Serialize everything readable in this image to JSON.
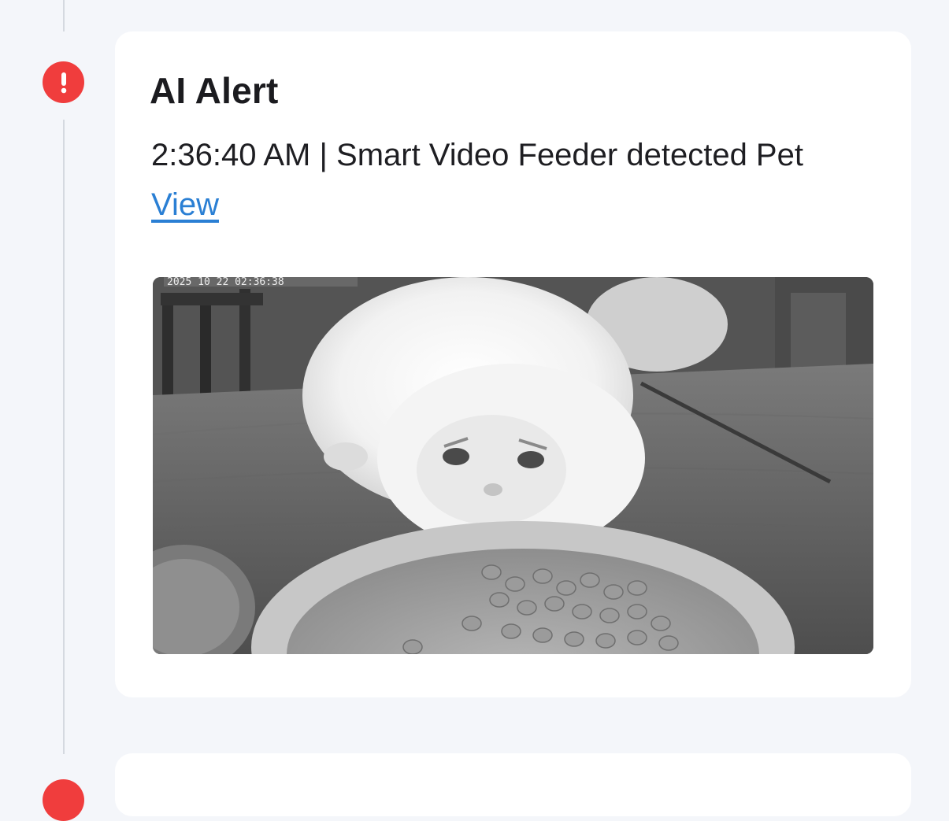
{
  "alerts": [
    {
      "title": "AI Alert",
      "time": "2:36:40 AM",
      "separator": "|",
      "description": "Smart Video Feeder detected Pet",
      "link_label": "View",
      "snapshot": {
        "overlay_text": "2025 10 22 02:36:38",
        "subject": "kitten eating from a food bowl",
        "color_mode": "grayscale"
      },
      "status_icon": "exclamation-icon",
      "status_color": "#f03d3d"
    }
  ],
  "colors": {
    "page_background": "#f4f6fa",
    "card_background": "#ffffff",
    "alert_red": "#f03d3d",
    "link_blue": "#2a7fd4",
    "timeline_line": "#d5d9e0"
  }
}
